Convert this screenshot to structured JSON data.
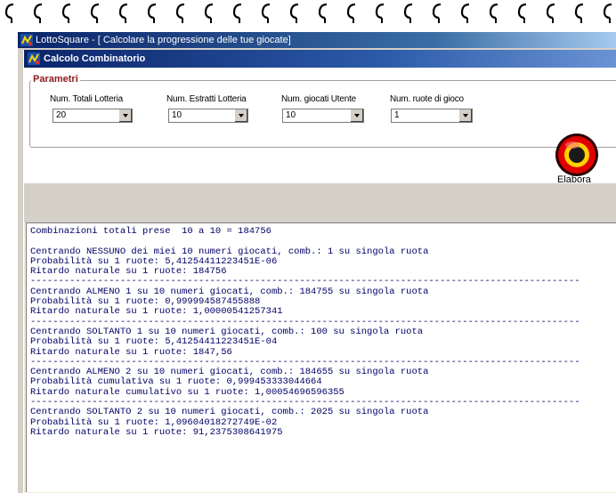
{
  "window": {
    "title": "LottoSquare - [ Calcolare la progressione delle tue giocate]"
  },
  "child_window": {
    "title": "Calcolo Combinatorio"
  },
  "parametri": {
    "legend": "Parametri",
    "fields": [
      {
        "label": "Num. Totali Lotteria",
        "value": "20"
      },
      {
        "label": "Num. Estratti Lotteria",
        "value": "10"
      },
      {
        "label": "Num. giocati Utente",
        "value": "10"
      },
      {
        "label": "Num. ruote di gioco",
        "value": "1"
      }
    ]
  },
  "elabora": {
    "label": "Elabora"
  },
  "output": {
    "lines": [
      "Combinazioni totali prese  10 a 10 = 184756",
      "",
      "Centrando NESSUNO dei miei 10 numeri giocati, comb.: 1 su singola ruota",
      "Probabilità su 1 ruote: 5,41254411223451E-06",
      "Ritardo naturale su 1 ruote: 184756",
      "--------------------------------------------------------------------------------------------------",
      "Centrando ALMENO 1 su 10 numeri giocati, comb.: 184755 su singola ruota",
      "Probabilità su 1 ruote: 0,999994587455888",
      "Ritardo naturale su 1 ruote: 1,00000541257341",
      "--------------------------------------------------------------------------------------------------",
      "Centrando SOLTANTO 1 su 10 numeri giocati, comb.: 100 su singola ruota",
      "Probabilità su 1 ruote: 5,41254411223451E-04",
      "Ritardo naturale su 1 ruote: 1847,56",
      "--------------------------------------------------------------------------------------------------",
      "Centrando ALMENO 2 su 10 numeri giocati, comb.: 184655 su singola ruota",
      "Probabilità cumulativa su 1 ruote: 0,999453333044664",
      "Ritardo naturale cumulativo su 1 ruote: 1,00054696596355",
      "--------------------------------------------------------------------------------------------------",
      "Centrando SOLTANTO 2 su 10 numeri giocati, comb.: 2025 su singola ruota",
      "Probabilità su 1 ruote: 1,09604018272749E-02",
      "Ritardo naturale su 1 ruote: 91,2375308641975"
    ]
  },
  "icons": {
    "binding": "spiral-ring-icon",
    "app": "lottosquare-app-icon",
    "elabora": "elabora-button-icon"
  },
  "colors": {
    "titlebar": "#0a246a",
    "output_text": "#000066",
    "legend": "#8b1a1a",
    "elabora_red": "#d00000"
  }
}
